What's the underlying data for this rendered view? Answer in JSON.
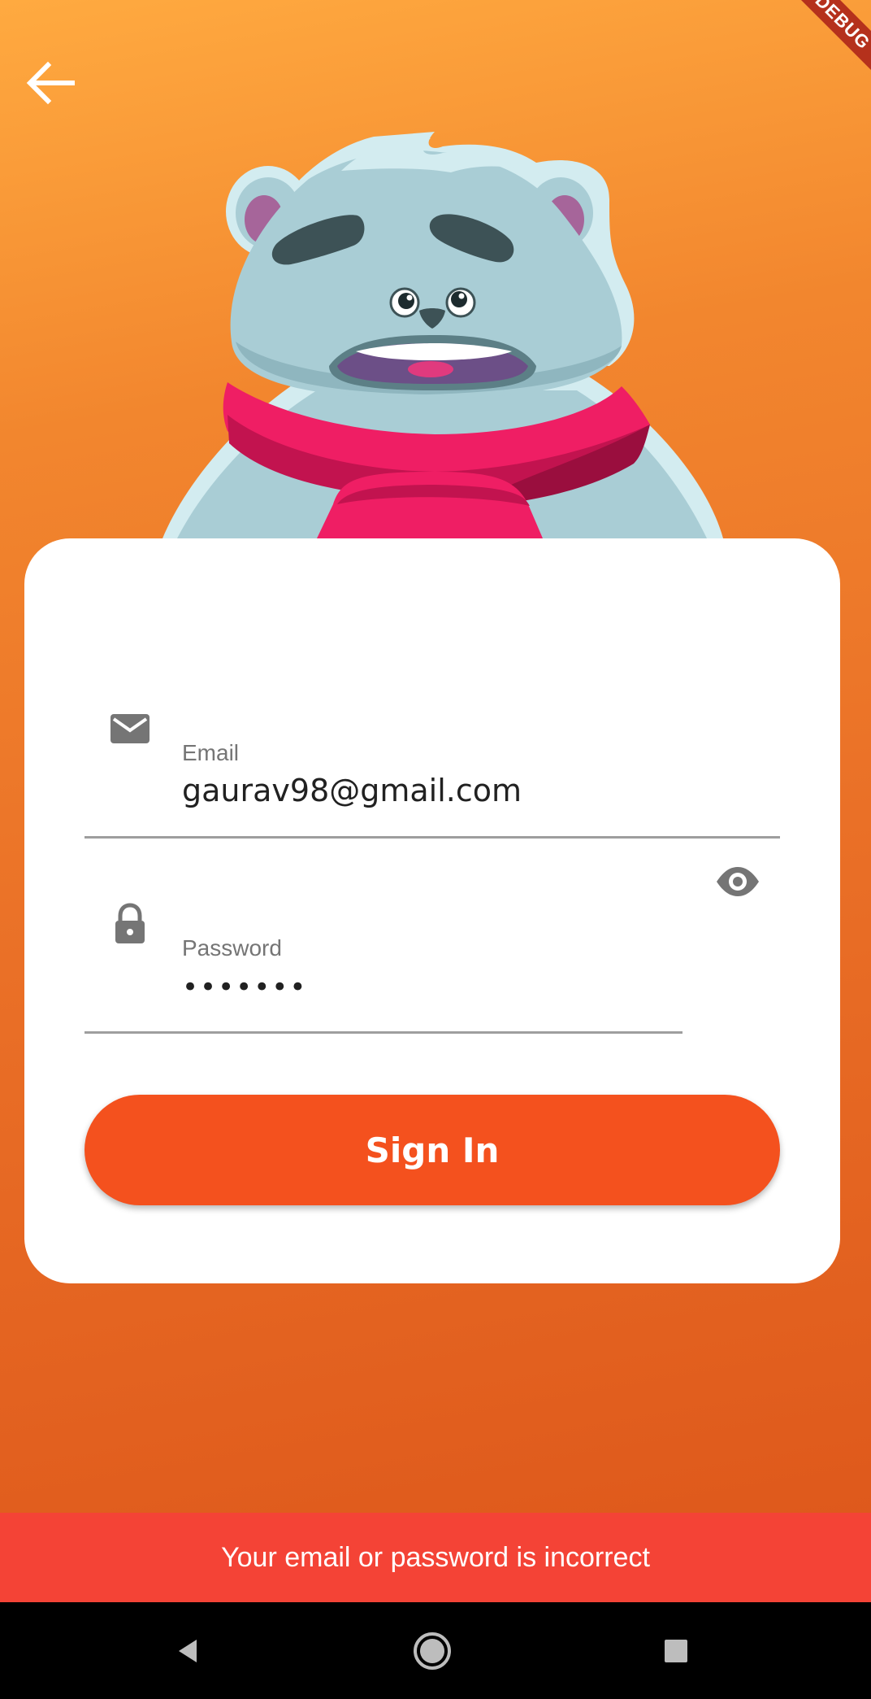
{
  "debug_banner": "DEBUG",
  "icons": {
    "back": "arrow-back-icon",
    "email": "mail-icon",
    "password": "lock-icon",
    "visibility": "eye-icon",
    "nav_back": "triangle-back-icon",
    "nav_home": "circle-home-icon",
    "nav_recents": "square-recents-icon"
  },
  "form": {
    "email_label": "Email",
    "email_value": "gaurav98@gmail.com",
    "password_label": "Password",
    "password_value": "•••••••",
    "submit_label": "Sign In"
  },
  "snackbar": {
    "message": "Your email or password is incorrect"
  },
  "colors": {
    "background_top": "#ffaa40",
    "background_bottom": "#dd561a",
    "button": "#f4511e",
    "snackbar": "#f44336",
    "card": "#ffffff"
  }
}
